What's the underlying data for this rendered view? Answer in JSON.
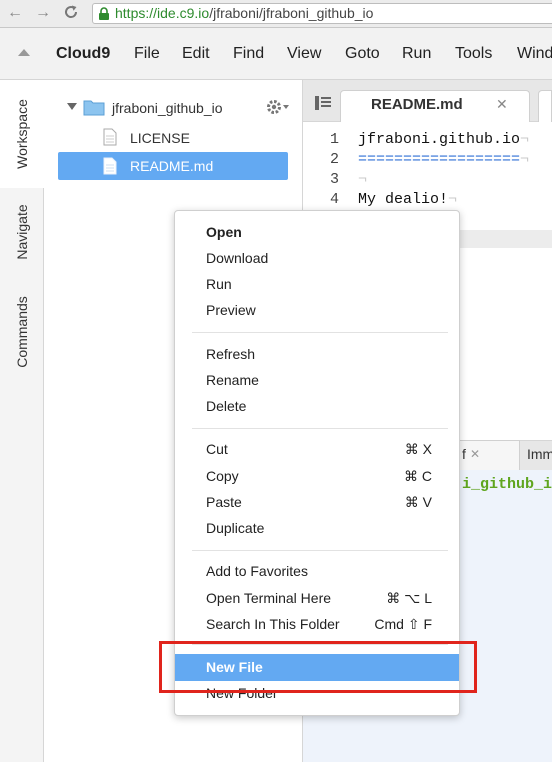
{
  "browser": {
    "url_scheme": "https://",
    "url_host": "ide.c9.io",
    "url_path": "/jfraboni/jfraboni_github_io",
    "back_icon": "arrow-left-icon",
    "forward_icon": "arrow-right-icon",
    "reload_icon": "reload-icon",
    "lock_icon": "lock-icon"
  },
  "menubar": {
    "brand": "Cloud9",
    "items": [
      "File",
      "Edit",
      "Find",
      "View",
      "Goto",
      "Run",
      "Tools",
      "Wind"
    ]
  },
  "sidetabs": {
    "workspace": "Workspace",
    "navigate": "Navigate",
    "commands": "Commands"
  },
  "tree": {
    "root": "jfraboni_github_io",
    "files": [
      "LICENSE",
      "README.md"
    ],
    "selected_file": "README.md"
  },
  "editor": {
    "tab_label": "README.md",
    "line_numbers": [
      "1",
      "2",
      "3",
      "4"
    ],
    "lines": [
      "jfraboni.github.io",
      "==================",
      "",
      "My dealio!"
    ],
    "eol_mark": "¬"
  },
  "lower": {
    "tab1_label": "f",
    "tab2_label": "Imm",
    "terminal_text": "i_github_io"
  },
  "context_menu": {
    "group1": [
      "Open",
      "Download",
      "Run",
      "Preview"
    ],
    "group2": [
      "Refresh",
      "Rename",
      "Delete"
    ],
    "group3": [
      {
        "label": "Cut",
        "shortcut": "⌘ X"
      },
      {
        "label": "Copy",
        "shortcut": "⌘ C"
      },
      {
        "label": "Paste",
        "shortcut": "⌘ V"
      },
      {
        "label": "Duplicate",
        "shortcut": ""
      }
    ],
    "group4": [
      {
        "label": "Add to Favorites",
        "shortcut": ""
      },
      {
        "label": "Open Terminal Here",
        "shortcut": "⌘ ⌥ L"
      },
      {
        "label": "Search In This Folder",
        "shortcut": "Cmd ⇧ F"
      }
    ],
    "group5": [
      "New File",
      "New Folder"
    ],
    "highlighted": "New File"
  },
  "colors": {
    "selection": "#63a9f2",
    "url_green": "#2e8b2e",
    "annotation_red": "#e0241c",
    "code_blue": "#2f6fd6",
    "terminal_green": "#5fa51e"
  }
}
